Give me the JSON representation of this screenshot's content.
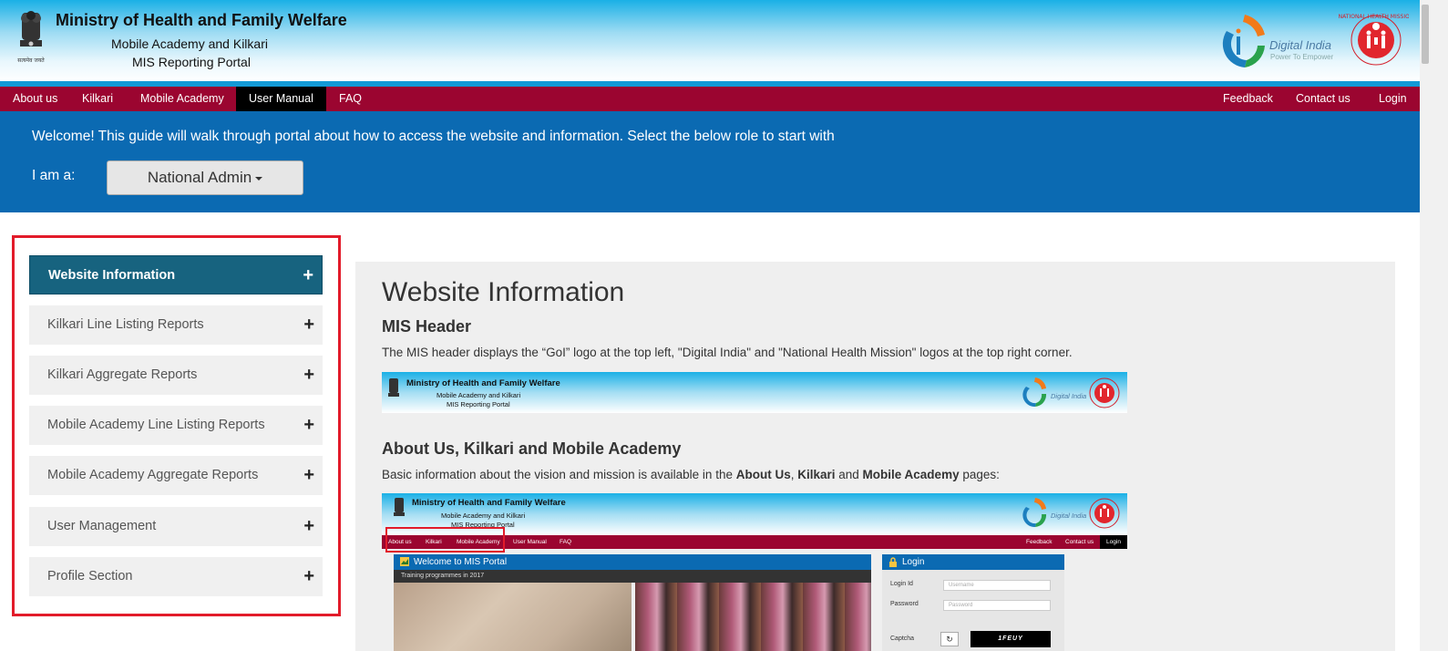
{
  "header": {
    "title": "Ministry of Health and Family Welfare",
    "subtitle1": "Mobile Academy and Kilkari",
    "subtitle2": "MIS Reporting Portal",
    "digital_india": "Digital India",
    "digital_india_tagline": "Power To Empower"
  },
  "nav": {
    "left": [
      "About us",
      "Kilkari",
      "Mobile Academy",
      "User Manual",
      "FAQ"
    ],
    "right": [
      "Feedback",
      "Contact us",
      "Login"
    ],
    "active": "User Manual"
  },
  "welcome": {
    "text": "Welcome! This guide will walk through portal about how to access the website and information. Select the below role to start with",
    "role_label": "I am a:",
    "role_value": "National Admin"
  },
  "sidebar": {
    "items": [
      {
        "label": "Website Information",
        "active": true
      },
      {
        "label": "Kilkari Line Listing Reports",
        "active": false
      },
      {
        "label": "Kilkari Aggregate Reports",
        "active": false
      },
      {
        "label": "Mobile Academy Line Listing Reports",
        "active": false
      },
      {
        "label": "Mobile Academy Aggregate Reports",
        "active": false
      },
      {
        "label": "User Management",
        "active": false
      },
      {
        "label": "Profile Section",
        "active": false
      }
    ],
    "expand_symbol": "+"
  },
  "main": {
    "title": "Website Information",
    "section1": {
      "heading": "MIS Header",
      "text": "The MIS header displays the “GoI” logo at the top left, \"Digital India\" and \"National Health Mission\" logos at the top right corner."
    },
    "section2": {
      "heading": "About Us, Kilkari and Mobile Academy",
      "text_prefix": "Basic information about the vision and mission is available in the ",
      "bold1": "About Us",
      "sep1": ", ",
      "bold2": "Kilkari",
      "sep2": " and ",
      "bold3": "Mobile Academy",
      "text_suffix": " pages:"
    }
  },
  "screenshot2": {
    "nav_left": [
      "About us",
      "Kilkari",
      "Mobile Academy",
      "User Manual",
      "FAQ"
    ],
    "nav_right": [
      "Feedback",
      "Contact us",
      "Login"
    ],
    "welcome_title": "Welcome to MIS Portal",
    "training_caption": "Training programmes in 2017",
    "login_title": "Login",
    "login_id_label": "Login Id",
    "login_id_placeholder": "Username",
    "password_label": "Password",
    "password_placeholder": "Password",
    "captcha_label": "Captcha",
    "captcha_value": "1FEUY"
  },
  "colors": {
    "nav_bg": "#9b0530",
    "welcome_bg": "#0b6ab2",
    "sidebar_active": "#17637f",
    "highlight_border": "#e21b2a"
  }
}
